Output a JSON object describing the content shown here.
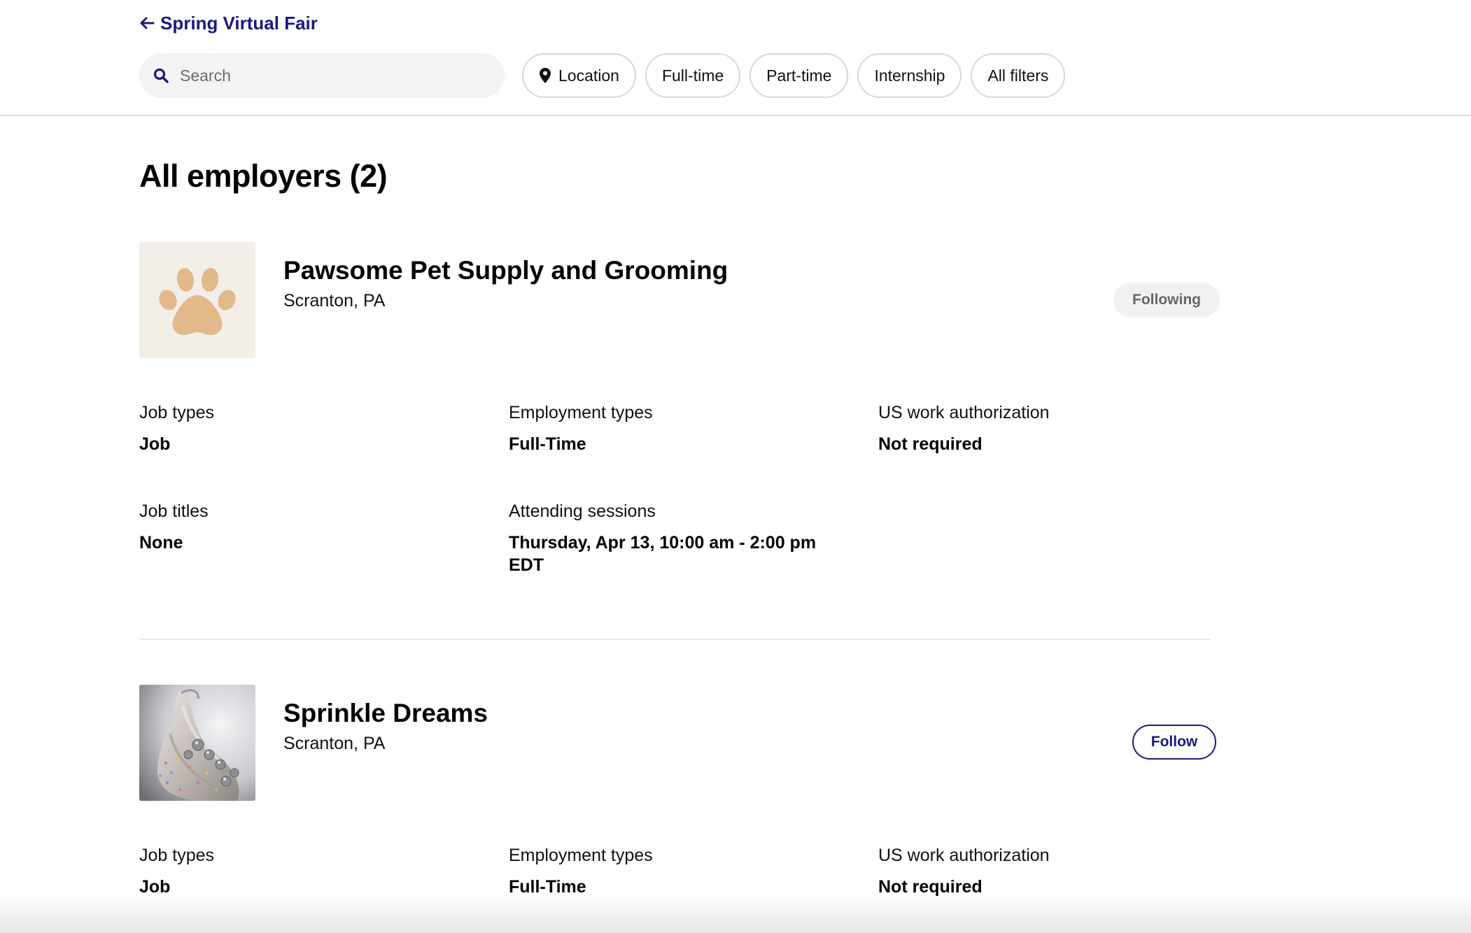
{
  "header": {
    "back_label": "Spring Virtual Fair",
    "search": {
      "placeholder": "Search",
      "value": ""
    },
    "filters": {
      "location": "Location",
      "full_time": "Full-time",
      "part_time": "Part-time",
      "internship": "Internship",
      "all_filters": "All filters"
    }
  },
  "main": {
    "title": "All employers (2)",
    "employers": [
      {
        "name": "Pawsome Pet Supply and Grooming",
        "location": "Scranton, PA",
        "follow_label": "Following",
        "logo_icon": "paw-icon",
        "details": {
          "job_types_label": "Job types",
          "job_types_value": "Job",
          "employment_types_label": "Employment types",
          "employment_types_value": "Full-Time",
          "work_auth_label": "US work authorization",
          "work_auth_value": "Not required",
          "job_titles_label": "Job titles",
          "job_titles_value": "None",
          "sessions_label": "Attending sessions",
          "sessions_value": "Thursday, Apr 13, 10:00 am - 2:00 pm EDT"
        }
      },
      {
        "name": "Sprinkle Dreams",
        "location": "Scranton, PA",
        "follow_label": "Follow",
        "logo_icon": "frosting-photo",
        "details": {
          "job_types_label": "Job types",
          "job_types_value": "Job",
          "employment_types_label": "Employment types",
          "employment_types_value": "Full-Time",
          "work_auth_label": "US work authorization",
          "work_auth_value": "Not required"
        }
      }
    ]
  },
  "colors": {
    "brand": "#1c1a7e",
    "paw": "#e2b98a",
    "following_bg": "#f1f1f2"
  }
}
